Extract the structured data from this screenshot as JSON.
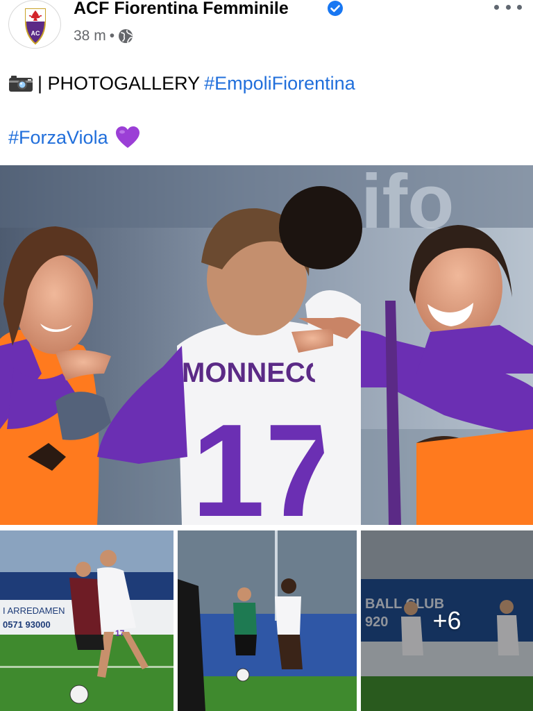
{
  "post": {
    "page_name": "ACF Fiorentina Femminile",
    "verified_icon": "verified-badge-icon",
    "timestamp": "38 m",
    "separator": "•",
    "privacy_icon": "globe-icon",
    "more_icon": "more-options-icon"
  },
  "text": {
    "camera_emoji": "📷",
    "prefix": "| PHOTOGALLERY",
    "hashtag1": "#EmpoliFiorentina",
    "hashtag2": "#ForzaViola",
    "heart_emoji": "💜"
  },
  "photos": {
    "main_jersey_name": "MONNECCHI",
    "main_jersey_number": "17",
    "thumb1_ad_text": "I ARREDAMEN",
    "thumb1_ad_phone": "0571 93000",
    "thumb3_banner_text": "BALL CLUB",
    "thumb3_banner_year": "920",
    "more_count_label": "+6"
  },
  "colors": {
    "fiorentina_purple": "#6b2fb3",
    "hashtag_blue": "#216fdb",
    "verified_blue": "#1877f2",
    "bib_orange": "#ff7a1e"
  }
}
